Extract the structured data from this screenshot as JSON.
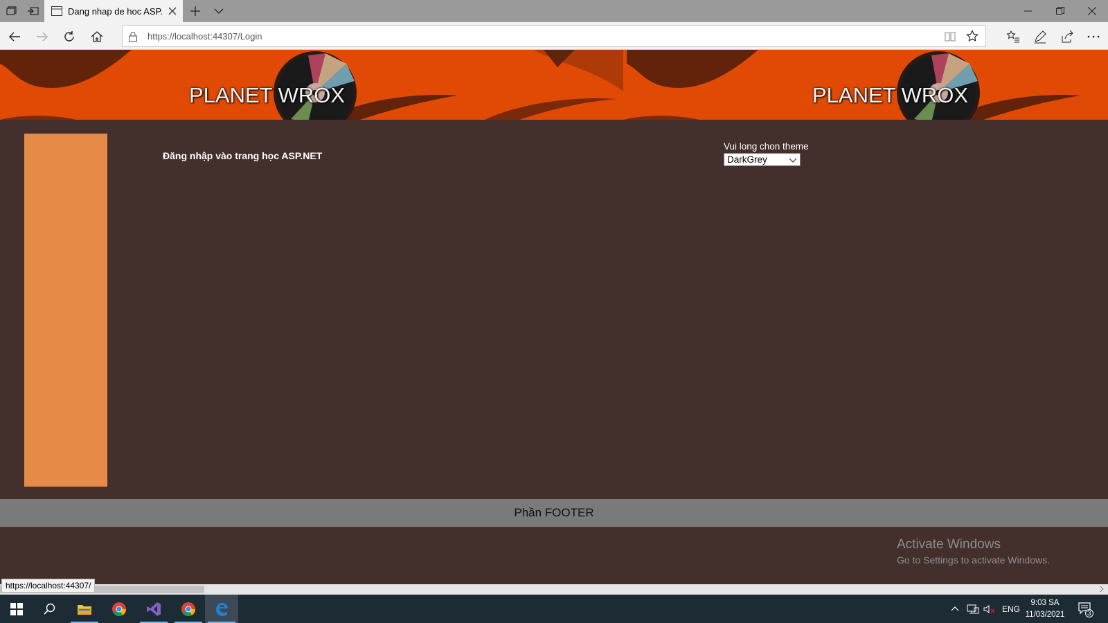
{
  "browser": {
    "tab_title": "Dang nhap de hoc ASP.",
    "url": "https://localhost:44307/Login",
    "status_url": "https://localhost:44307/"
  },
  "page": {
    "banner_title": "PLANET WROX",
    "main_text": "Đăng nhập vào trang học ASP.NET",
    "theme": {
      "label": "Vui long chon theme",
      "selected": "DarkGrey"
    },
    "footer": "Phần FOOTER"
  },
  "watermark": {
    "line1": "Activate Windows",
    "line2": "Go to Settings to activate Windows."
  },
  "taskbar": {
    "language": "ENG",
    "time": "9:03 SA",
    "date": "11/03/2021",
    "notification_count": "3"
  },
  "colors": {
    "header_orange": "#e04a05",
    "page_bg": "#432f2b",
    "sidebar": "#e68a47",
    "footer_bg": "#7a7a7a"
  }
}
